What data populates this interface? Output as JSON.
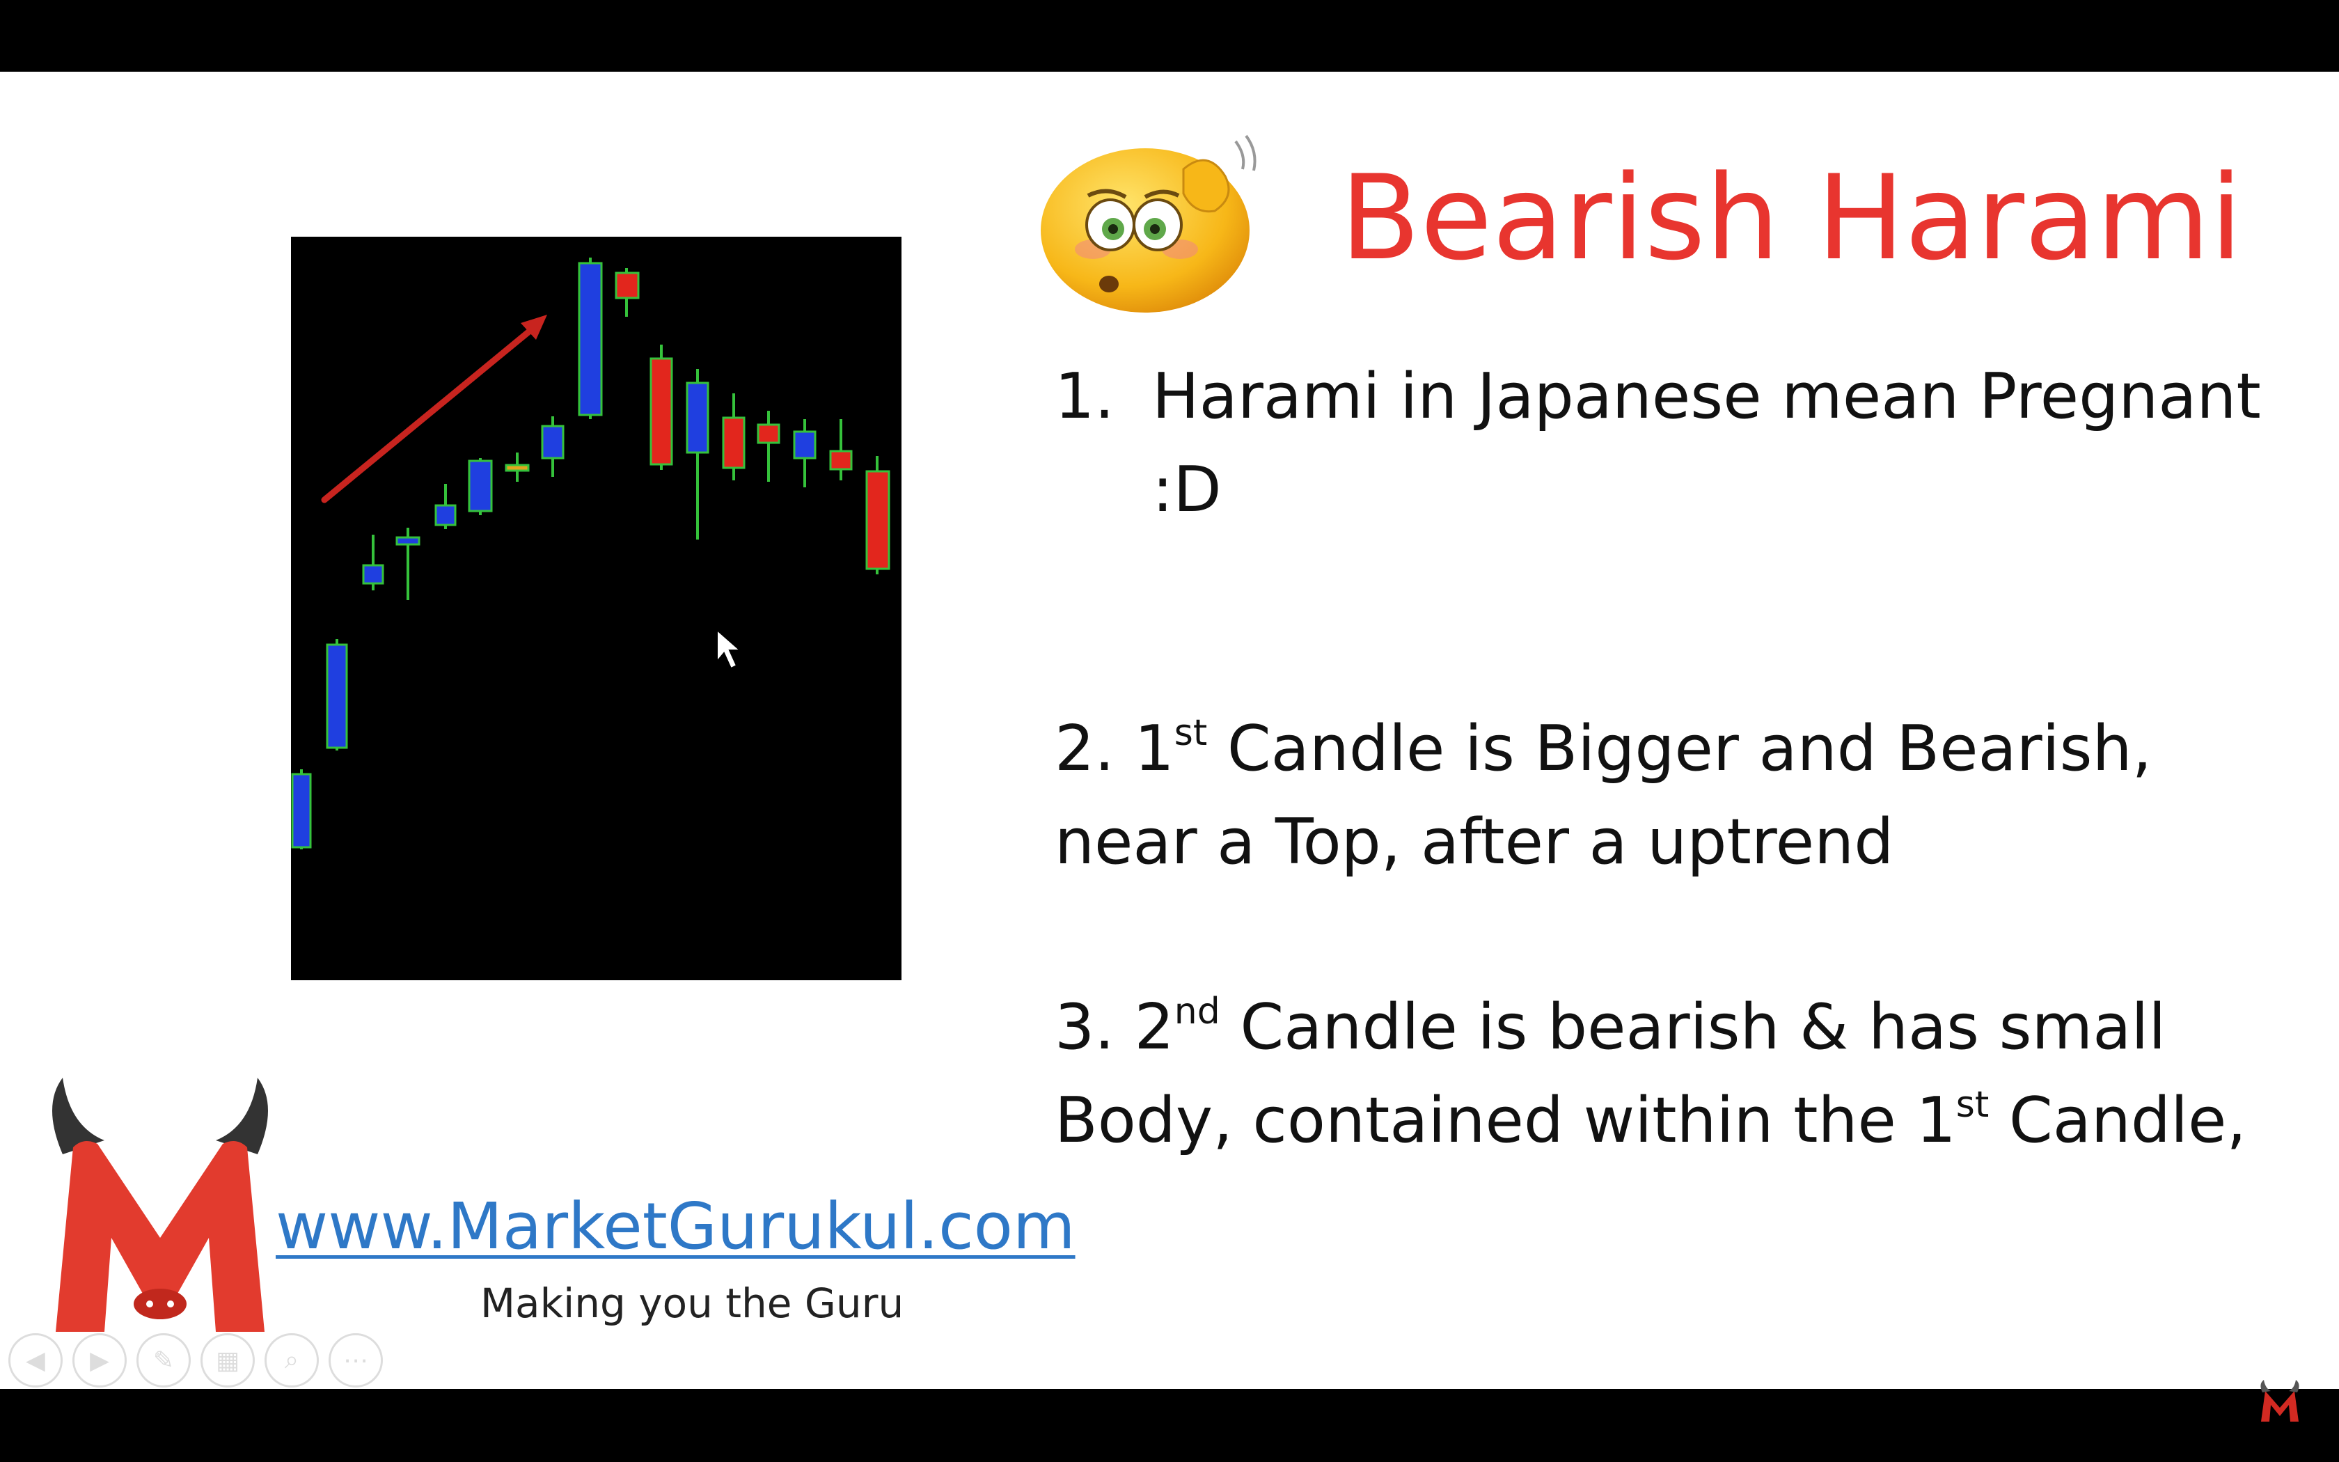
{
  "slide": {
    "title": "Bearish Harami",
    "points": [
      {
        "num": "1.",
        "line1": "Harami in Japanese mean Pregnant",
        "line2": ":D"
      },
      {
        "prefix": "2. 1",
        "sup": "st",
        "line1_rest": " Candle is Bigger and Bearish,",
        "line2": "near a Top, after a uptrend"
      },
      {
        "prefix": "3. 2",
        "sup": "nd",
        "line1_rest": " Candle is bearish & has small",
        "line2_a": "Body, contained within the 1",
        "line2_sup": "st",
        "line2_b": " Candle,"
      }
    ],
    "website": "www.MarketGurukul.com",
    "tagline": "Making you the Guru"
  },
  "colors": {
    "title": "#e8352f",
    "bullish_candle": "#1f3fe0",
    "bearish_candle": "#e2261d",
    "candle_outline": "#35c23b",
    "arrow": "#c8241f",
    "link": "#2e78c7"
  },
  "icons": [
    "confused-emoji-icon",
    "bull-m-logo-icon",
    "prev-slide-icon",
    "next-slide-icon",
    "pen-icon",
    "slides-icon",
    "zoom-icon",
    "more-icon",
    "corner-m-logo-icon"
  ]
}
